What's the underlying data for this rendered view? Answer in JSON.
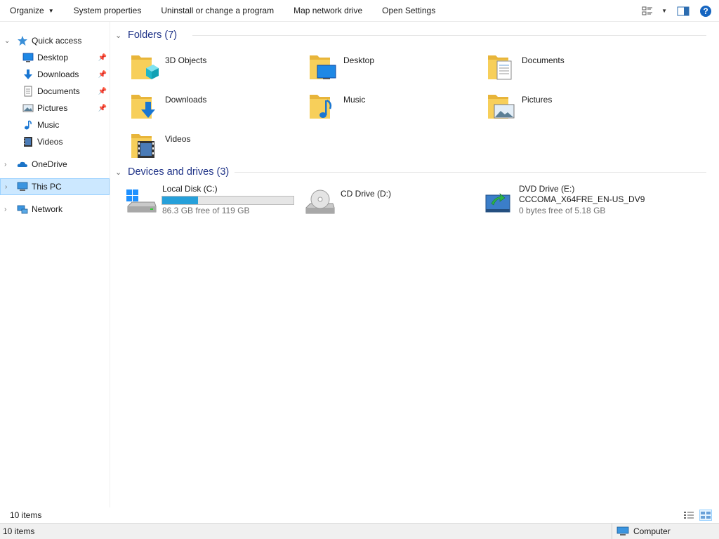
{
  "toolbar": {
    "items": [
      "Organize",
      "System properties",
      "Uninstall or change a program",
      "Map network drive",
      "Open Settings"
    ],
    "icons": [
      "change-view-icon",
      "preview-pane-icon",
      "help-icon"
    ]
  },
  "nav": {
    "quick_access": "Quick access",
    "quick_items": [
      {
        "label": "Desktop",
        "icon": "desktop-icon",
        "pinned": true
      },
      {
        "label": "Downloads",
        "icon": "downloads-icon",
        "pinned": true
      },
      {
        "label": "Documents",
        "icon": "documents-icon",
        "pinned": true
      },
      {
        "label": "Pictures",
        "icon": "pictures-icon",
        "pinned": true
      },
      {
        "label": "Music",
        "icon": "music-icon",
        "pinned": false
      },
      {
        "label": "Videos",
        "icon": "videos-icon",
        "pinned": false
      }
    ],
    "onedrive": "OneDrive",
    "this_pc": "This PC",
    "network": "Network"
  },
  "folders": {
    "header": "Folders (7)",
    "items": [
      "3D Objects",
      "Desktop",
      "Documents",
      "Downloads",
      "Music",
      "Pictures",
      "Videos"
    ]
  },
  "drives": {
    "header": "Devices and drives (3)",
    "items": [
      {
        "name": "Local Disk (C:)",
        "free": "86.3 GB free of 119 GB",
        "used_fraction": 0.275
      },
      {
        "name": "CD Drive (D:)"
      },
      {
        "name": "DVD Drive (E:)",
        "label": "CCCOMA_X64FRE_EN-US_DV9",
        "free": "0 bytes free of 5.18 GB"
      }
    ]
  },
  "status": {
    "count": "10 items",
    "bottom_count": "10 items",
    "zone": "Computer"
  },
  "colors": {
    "accent": "#26a0da",
    "selection": "#cce8ff",
    "group_header": "#1e3287",
    "folder": "#f5c842"
  }
}
